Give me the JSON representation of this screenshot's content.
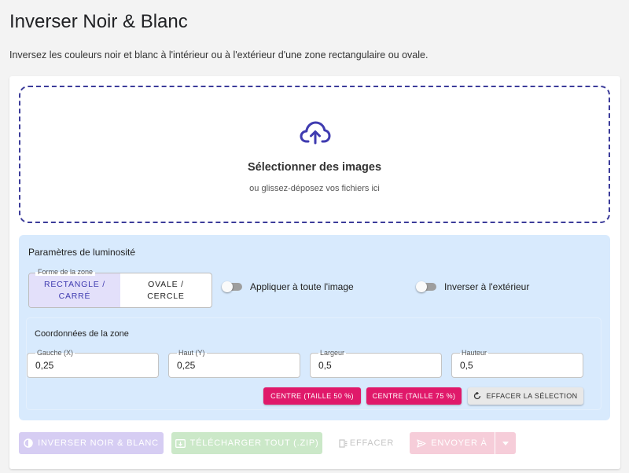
{
  "page": {
    "title": "Inverser Noir & Blanc",
    "description": "Inversez les couleurs noir et blanc à l'intérieur ou à l'extérieur d'une zone rectangulaire ou ovale."
  },
  "dropzone": {
    "icon": "cloud-upload-icon",
    "title": "Sélectionner des images",
    "subtitle": "ou glissez-déposez vos fichiers ici"
  },
  "settings": {
    "title": "Paramètres de luminosité",
    "shape": {
      "legend": "Forme de la zone",
      "options": [
        "RECTANGLE / CARRÉ",
        "OVALE / CERCLE"
      ],
      "selected": "RECTANGLE / CARRÉ"
    },
    "apply_whole": {
      "label": "Appliquer à toute l'image",
      "checked": false
    },
    "invert_outside": {
      "label": "Inverser à l'extérieur",
      "checked": false
    },
    "coords": {
      "title": "Coordonnées de la zone",
      "fields": [
        {
          "label": "Gauche (X)",
          "value": "0,25"
        },
        {
          "label": "Haut (Y)",
          "value": "0,25"
        },
        {
          "label": "Largeur",
          "value": "0,5"
        },
        {
          "label": "Hauteur",
          "value": "0,5"
        }
      ],
      "center50_label": "CENTRE (TAILLE 50 %)",
      "center75_label": "CENTRE (TAILLE 75 %)",
      "clear_selection_label": "EFFACER LA SÉLECTION"
    }
  },
  "actions": {
    "invert_label": "INVERSER NOIR & BLANC",
    "download_label": "TÉLÉCHARGER TOUT (.ZIP)",
    "clear_label": "EFFACER",
    "send_label": "ENVOYER À"
  },
  "colors": {
    "accent": "#3f3bb0",
    "pink": "#e0196a",
    "panel_bg": "#d8eafd"
  }
}
